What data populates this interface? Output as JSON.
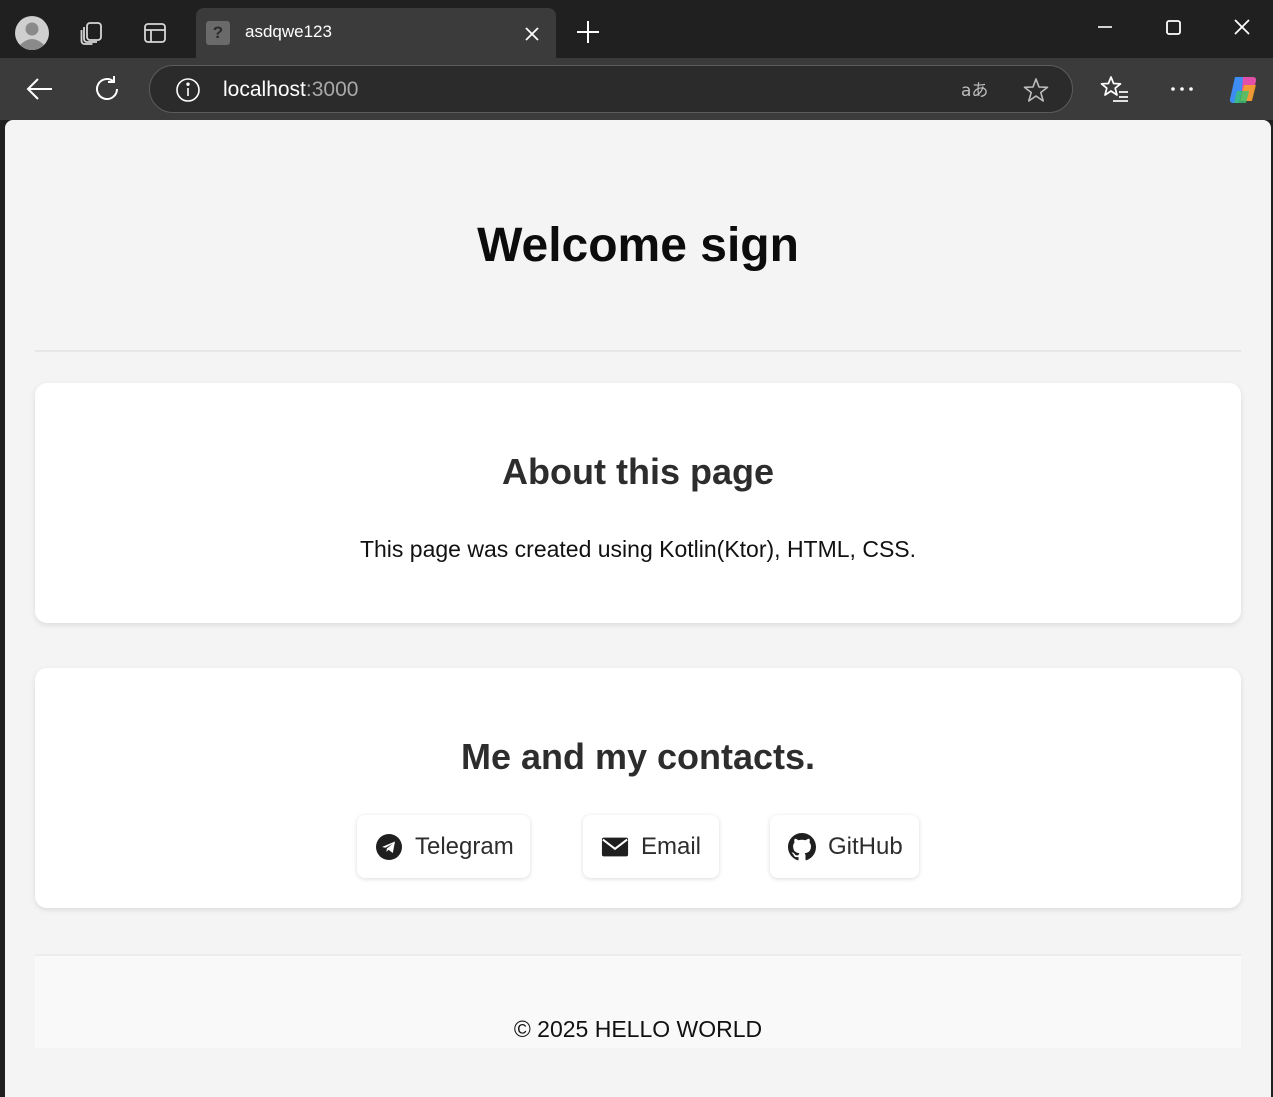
{
  "browser": {
    "tab_title": "asdqwe123",
    "tab_favicon": "?",
    "url_host": "localhost",
    "url_port": ":3000"
  },
  "page": {
    "title": "Welcome sign",
    "about": {
      "heading": "About this page",
      "text": "This page was created using Kotlin(Ktor), HTML, CSS."
    },
    "contacts": {
      "heading": "Me and my contacts.",
      "buttons": [
        {
          "label": "Telegram",
          "icon": "telegram-icon"
        },
        {
          "label": "Email",
          "icon": "email-icon"
        },
        {
          "label": "GitHub",
          "icon": "github-icon"
        }
      ]
    },
    "footer": "© 2025 HELLO WORLD"
  }
}
